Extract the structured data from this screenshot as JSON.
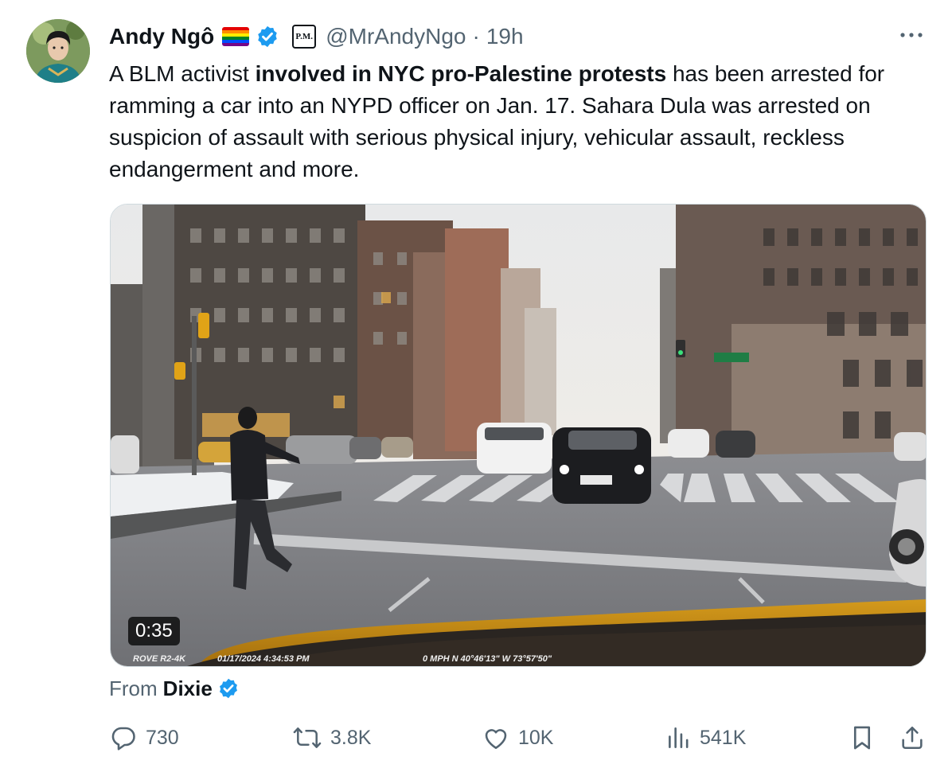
{
  "author": {
    "name": "Andy Ngô",
    "handle": "@MrAndyNgo",
    "separator": "·",
    "time": "19h",
    "badge_text": "P.M.",
    "verified_color": "#1d9bf0"
  },
  "tweet": {
    "segments": [
      {
        "text": "A BLM activist ",
        "bold": false
      },
      {
        "text": "involved in NYC pro-Palestine protests",
        "bold": true
      },
      {
        "text": " has been arrested for ramming a car into an NYPD officer on Jan. 17. Sahara Dula was arrested on suspicion of assault with serious physical injury, vehicular assault, reckless endangerment and more.",
        "bold": false
      }
    ]
  },
  "media": {
    "duration": "0:35",
    "overlay_brand": "ROVE R2-4K",
    "overlay_datetime": "01/17/2024  4:34:53 PM",
    "overlay_gps": "0 MPH   N 40°46'13\"  W 73°57'50\""
  },
  "source": {
    "prefix": "From",
    "name": "Dixie"
  },
  "actions": {
    "replies": "730",
    "reposts": "3.8K",
    "likes": "10K",
    "views": "541K"
  },
  "colors": {
    "text": "#0f1419",
    "secondary": "#536471",
    "accent": "#1d9bf0"
  },
  "icons": [
    "more-icon",
    "verified-icon",
    "reply-icon",
    "repost-icon",
    "like-icon",
    "views-icon",
    "bookmark-icon",
    "share-icon"
  ]
}
